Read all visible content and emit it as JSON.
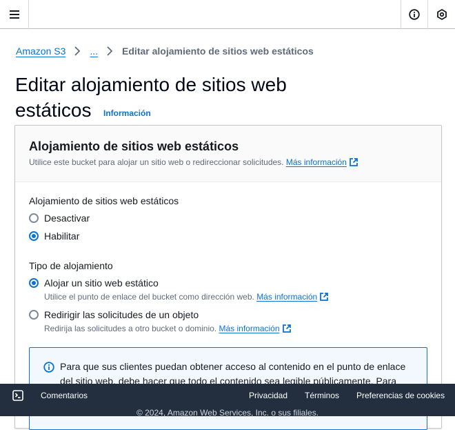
{
  "topbar": {
    "menu_icon": "hamburger-menu-icon",
    "info_icon": "info-icon",
    "settings_icon": "settings-hex-icon"
  },
  "breadcrumb": {
    "items": [
      "Amazon S3",
      "..."
    ],
    "current": "Editar alojamiento de sitios web estáticos"
  },
  "page": {
    "title": "Editar alojamiento de sitios web estáticos",
    "info_link": "Información"
  },
  "container": {
    "header": "Alojamiento de sitios web estáticos",
    "description": "Utilice este bucket para alojar un sitio web o redireccionar solicitudes.",
    "more_info": "Más información"
  },
  "hosting": {
    "label": "Alojamiento de sitios web estáticos",
    "options": [
      "Desactivar",
      "Habilitar"
    ],
    "selected": "Habilitar"
  },
  "hosting_type": {
    "label": "Tipo de alojamiento",
    "options": [
      {
        "label": "Alojar un sitio web estático",
        "description": "Utilice el punto de enlace del bucket como dirección web.",
        "more_info": "Más información"
      },
      {
        "label": "Redirigir las solicitudes de un objeto",
        "description": "Redirija las solicitudes a otro bucket o dominio.",
        "more_info": "Más información"
      }
    ],
    "selected": "Alojar un sitio web estático"
  },
  "alert": {
    "text": "Para que sus clientes puedan obtener acceso al contenido en el punto de enlace del sitio web, debe hacer que todo el contenido sea legible públicamente. Para"
  },
  "footer": {
    "cloudshell_icon": "cloudshell-icon",
    "feedback": "Comentarios",
    "privacy": "Privacidad",
    "terms": "Términos",
    "cookies": "Preferencias de cookies",
    "copyright": "© 2024, Amazon Web Services, Inc. o sus filiales."
  },
  "colors": {
    "link": "#0972d3",
    "footer_bg": "#232f3e",
    "alert_bg": "#f2f8fd",
    "text": "#16191f",
    "secondary_text": "#5f6b7a"
  }
}
